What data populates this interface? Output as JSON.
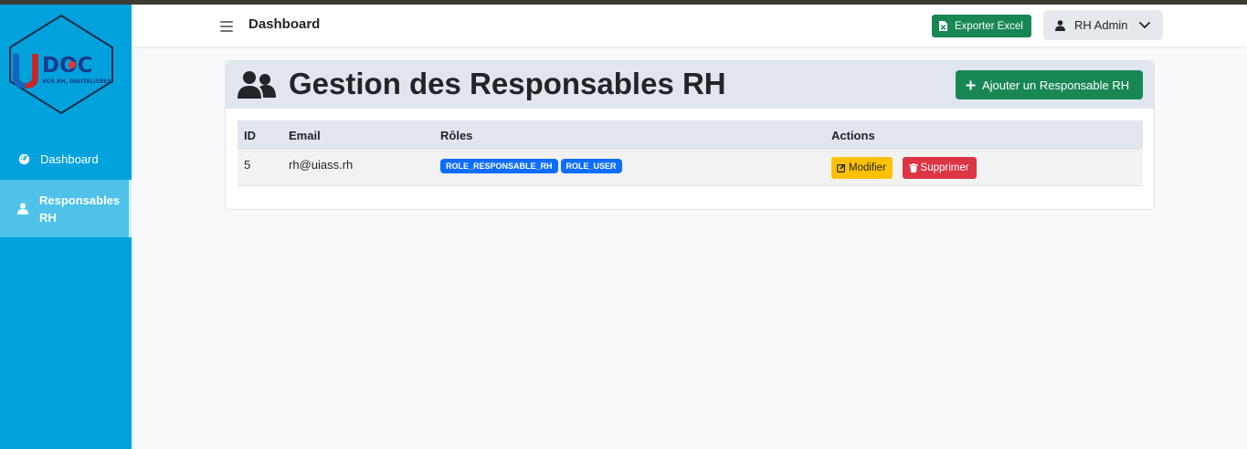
{
  "brand": {
    "logo_text": "DOC",
    "logo_letter": "U",
    "tagline": "VOS RH, DIGITALISÉES."
  },
  "sidebar": {
    "items": [
      {
        "label": "Dashboard",
        "icon": "gauge-icon",
        "active": false
      },
      {
        "label": "Responsables RH",
        "icon": "user-icon",
        "active": true
      }
    ]
  },
  "topbar": {
    "title": "Dashboard",
    "export_label": "Exporter Excel",
    "user_label": "RH Admin"
  },
  "page": {
    "title": "Gestion des Responsables RH",
    "add_label": "Ajouter un Responsable RH"
  },
  "table": {
    "columns": [
      "ID",
      "Email",
      "Rôles",
      "Actions"
    ],
    "rows": [
      {
        "id": "5",
        "email": "rh@uiass.rh",
        "roles": [
          "ROLE_RESPONSABLE_RH",
          "ROLE_USER"
        ],
        "edit_label": "Modifier",
        "delete_label": "Supprimer"
      }
    ]
  },
  "colors": {
    "sidebar": "#00a2dd",
    "sidebar_active": "#4fc2e9",
    "success": "#198754",
    "warning": "#ffc107",
    "danger": "#dc3545",
    "primary": "#0d6efd"
  }
}
